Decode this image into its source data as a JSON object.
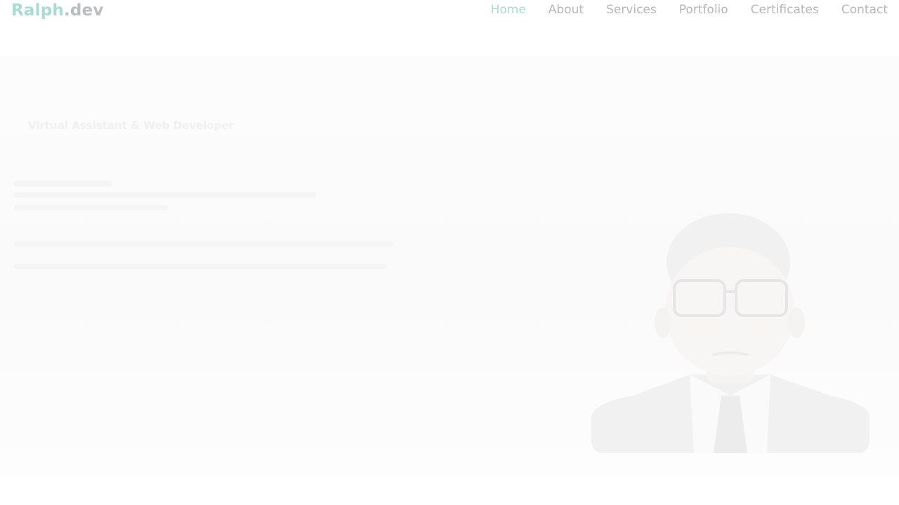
{
  "header": {
    "logo_main": "Ralph",
    "logo_suffix": ".dev",
    "logo_colors": {
      "main": "#a9dbd6",
      "suffix": "#b9bec3"
    },
    "nav": [
      {
        "label": "Home",
        "active": true
      },
      {
        "label": "About",
        "active": false
      },
      {
        "label": "Services",
        "active": false
      },
      {
        "label": "Portfolio",
        "active": false
      },
      {
        "label": "Certificates",
        "active": false
      },
      {
        "label": "Contact",
        "active": false
      }
    ]
  },
  "hero": {
    "role": "Virtual Assistant & Web Developer",
    "photo_icon": "profile-photo"
  }
}
